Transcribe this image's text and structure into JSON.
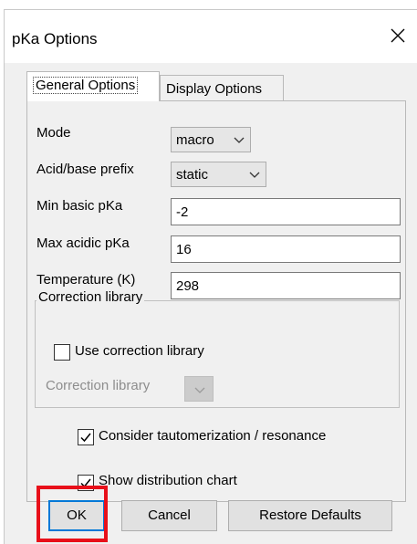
{
  "window": {
    "title": "pKa Options"
  },
  "tabs": [
    {
      "label": "General Options"
    },
    {
      "label": "Display Options"
    }
  ],
  "general": {
    "mode_label": "Mode",
    "mode_value": "macro",
    "prefix_label": "Acid/base prefix",
    "prefix_value": "static",
    "min_basic_label": "Min basic pKa",
    "min_basic_value": "-2",
    "max_acidic_label": "Max acidic pKa",
    "max_acidic_value": "16",
    "temperature_label": "Temperature (K)",
    "temperature_value": "298"
  },
  "correction": {
    "group_title": "Correction library",
    "use_label": "Use correction library",
    "use_checked": false,
    "library_label": "Correction library",
    "library_value": ""
  },
  "options": {
    "tautomer_label": "Consider tautomerization / resonance",
    "tautomer_checked": true,
    "distribution_label": "Show distribution chart",
    "distribution_checked": true
  },
  "buttons": {
    "ok": "OK",
    "cancel": "Cancel",
    "restore": "Restore Defaults"
  },
  "icons": {
    "close": "close-icon",
    "chevron": "chevron-down-icon",
    "check": "check-icon"
  },
  "colors": {
    "highlight": "#e8101a",
    "default_button_border": "#0078d7",
    "dialog_bg": "#f0f0f0"
  }
}
